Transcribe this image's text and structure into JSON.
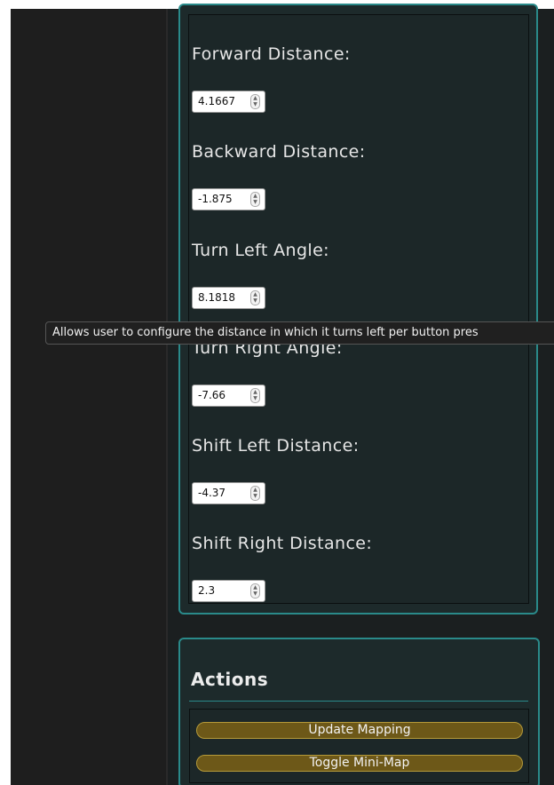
{
  "settings": {
    "fields": [
      {
        "label": "Forward Distance:",
        "value": "4.1667"
      },
      {
        "label": "Backward Distance:",
        "value": "-1.875"
      },
      {
        "label": "Turn Left Angle:",
        "value": "8.1818"
      },
      {
        "label": "Turn Right Angle:",
        "value": "-7.66"
      },
      {
        "label": "Shift Left Distance:",
        "value": "-4.37"
      },
      {
        "label": "Shift Right Distance:",
        "value": "2.3"
      }
    ]
  },
  "tooltip": {
    "text": "Allows user to configure the distance in which it turns left per button pres"
  },
  "actions": {
    "title": "Actions",
    "buttons": [
      {
        "label": "Update Mapping"
      },
      {
        "label": "Toggle Mini-Map"
      }
    ]
  },
  "colors": {
    "accent_border": "#2a8a8a",
    "button_fill": "#6d5818",
    "button_border": "#b59a3a",
    "panel_bg": "#1c2728"
  }
}
